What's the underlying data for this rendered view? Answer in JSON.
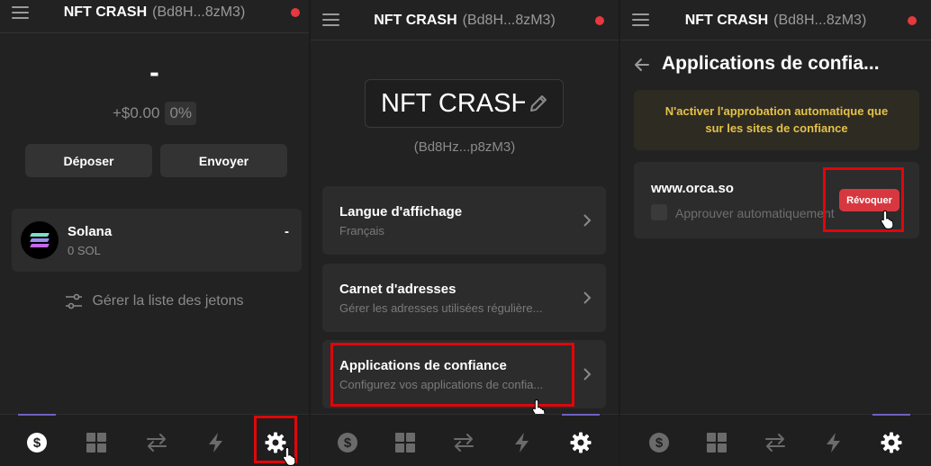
{
  "wallet": {
    "name": "NFT CRASH",
    "address_short": "(Bd8H...8zM3)",
    "address_alt": "(Bd8Hz...p8zM3)"
  },
  "home": {
    "balance": "-",
    "change_amount": "+$0.00",
    "change_pct": "0%",
    "deposit_label": "Déposer",
    "send_label": "Envoyer",
    "token": {
      "name": "Solana",
      "amount": "0 SOL",
      "value": "-"
    },
    "manage_tokens_label": "Gérer la liste des jetons"
  },
  "settings": {
    "display_name": "NFT CRASH",
    "address": "(Bd8Hz...p8zM3)",
    "items": [
      {
        "title": "Langue d'affichage",
        "subtitle": "Français"
      },
      {
        "title": "Carnet d'adresses",
        "subtitle": "Gérer les adresses utilisées régulière..."
      },
      {
        "title": "Applications de confiance",
        "subtitle": "Configurez vos applications de confia..."
      }
    ]
  },
  "trusted": {
    "title": "Applications de confia...",
    "warning_line1": "N'activer l'approbation automatique que",
    "warning_line2": "sur les sites de confiance",
    "site": "www.orca.so",
    "auto_approve_label": "Approuver automatiquement",
    "revoke_label": "Révoquer"
  },
  "nav_icons": [
    "dollar-icon",
    "grid-icon",
    "swap-icon",
    "bolt-icon",
    "gear-icon"
  ],
  "colors": {
    "accent": "#6f61c0",
    "danger": "#d7383f",
    "warning_text": "#e4c24a",
    "highlight": "#e0060a"
  }
}
